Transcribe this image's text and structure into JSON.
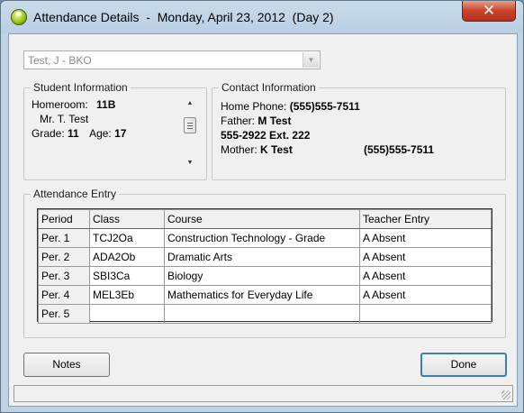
{
  "window": {
    "title": "Attendance Details  -  Monday, April 23, 2012  (Day 2)",
    "close_label": "✕"
  },
  "student_select": {
    "value": "Test, J - BKO"
  },
  "student_info": {
    "legend": "Student Information",
    "homeroom_label": "Homeroom:",
    "homeroom_value": "11B",
    "teacher": "Mr. T. Test",
    "grade_label": "Grade:",
    "grade_value": "11",
    "age_label": "Age:",
    "age_value": "17"
  },
  "contact_info": {
    "legend": "Contact Information",
    "home_phone_label": "Home Phone:",
    "home_phone_value": "(555)555-7511",
    "father_label": "Father:",
    "father_value": "M Test",
    "father_phone": "555-2922 Ext. 222",
    "mother_label": "Mother:",
    "mother_value": "K Test",
    "mother_phone": "(555)555-7511"
  },
  "attendance": {
    "legend": "Attendance Entry",
    "columns": [
      "Period",
      "Class",
      "Course",
      "Teacher Entry"
    ],
    "rows": [
      {
        "period": "Per. 1",
        "class": "TCJ2Oa",
        "course": "Construction Technology - Grade",
        "entry": "A Absent"
      },
      {
        "period": "Per. 2",
        "class": "ADA2Ob",
        "course": "Dramatic Arts",
        "entry": "A Absent"
      },
      {
        "period": "Per. 3",
        "class": "SBI3Ca",
        "course": "Biology",
        "entry": "A Absent"
      },
      {
        "period": "Per. 4",
        "class": "MEL3Eb",
        "course": "Mathematics for Everyday Life",
        "entry": "A Absent"
      },
      {
        "period": "Per. 5",
        "class": "",
        "course": "",
        "entry": ""
      }
    ]
  },
  "buttons": {
    "notes": "Notes",
    "done": "Done"
  }
}
